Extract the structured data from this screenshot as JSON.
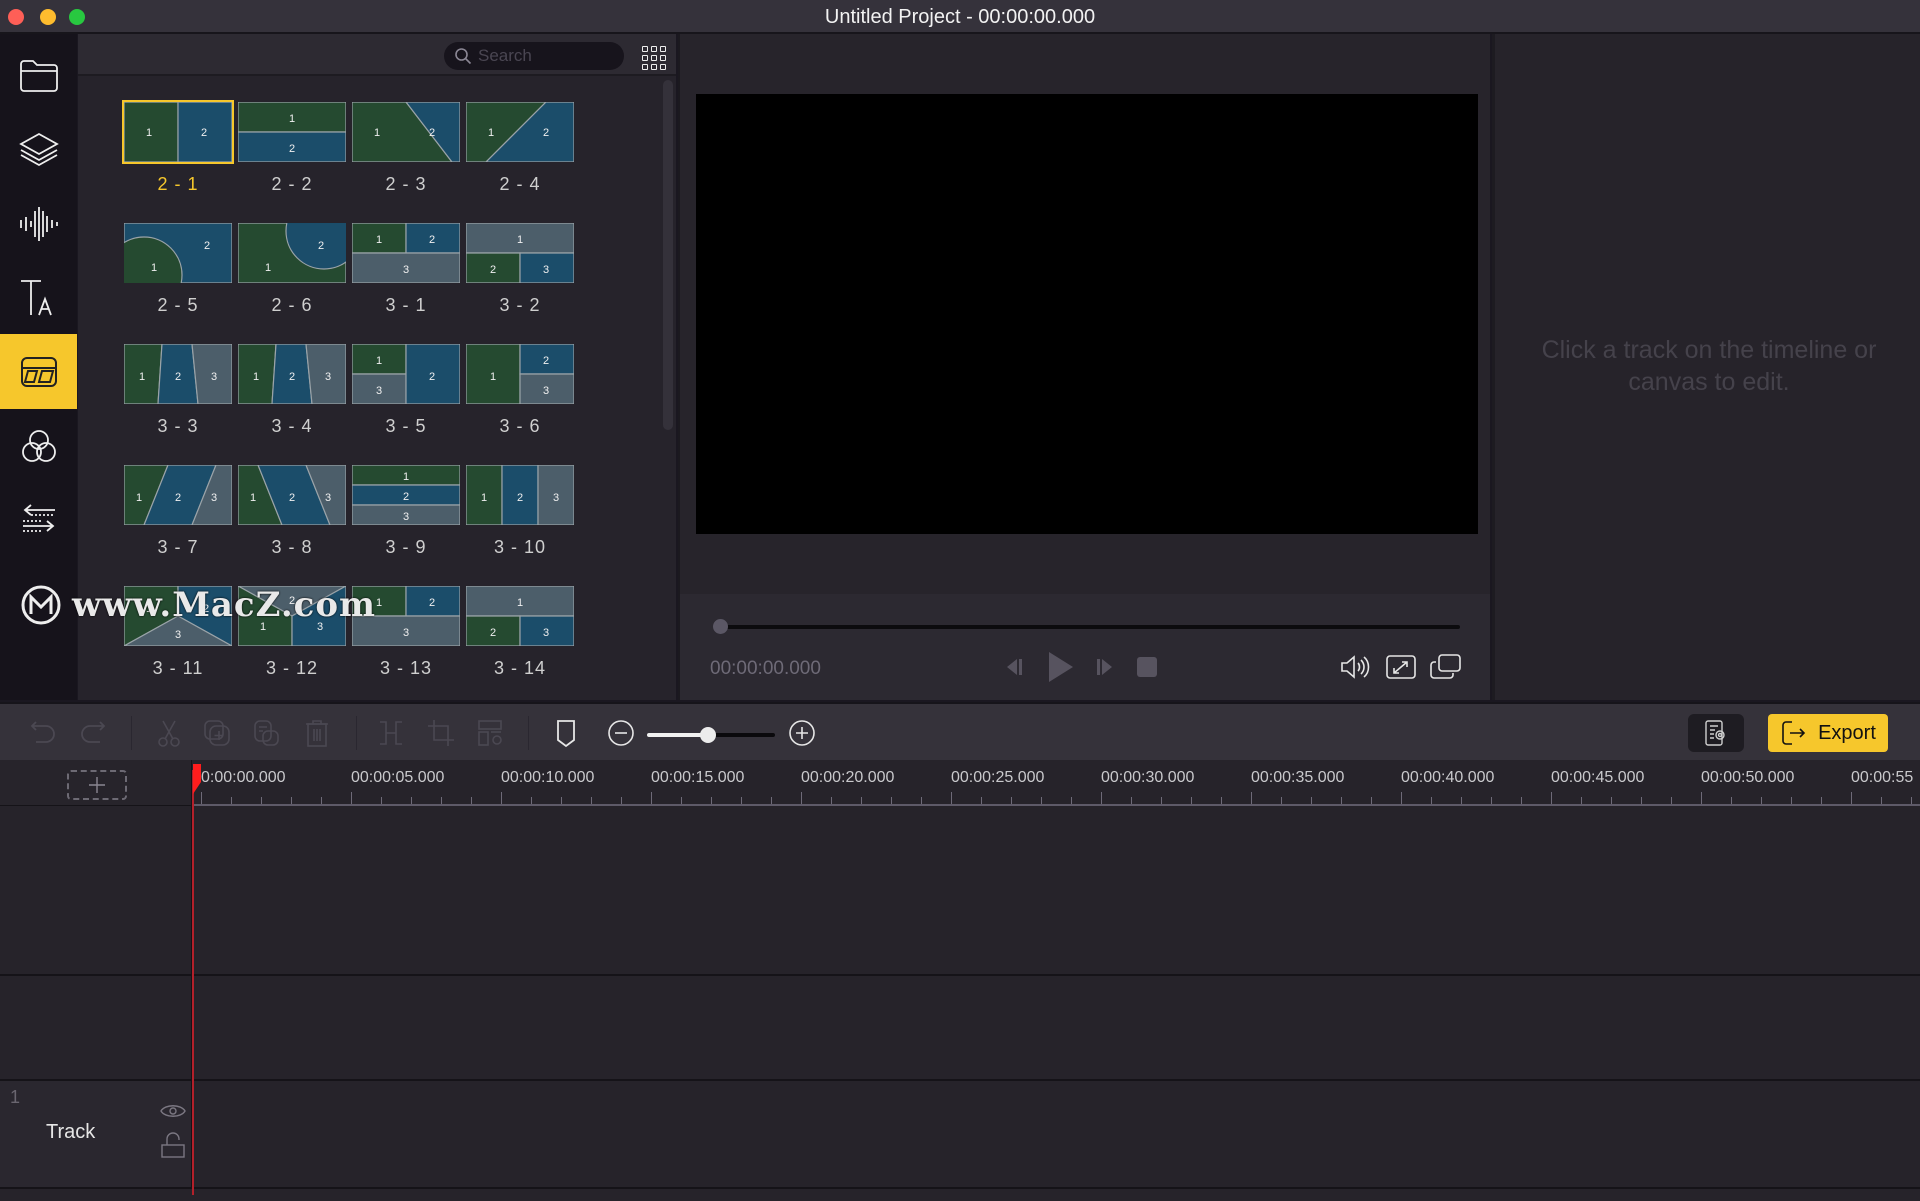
{
  "window": {
    "title": "Untitled Project - 00:00:00.000",
    "traffic_lights": [
      {
        "name": "close",
        "color": "#fe5f57"
      },
      {
        "name": "minimize",
        "color": "#febc2e"
      },
      {
        "name": "zoom",
        "color": "#28c840"
      }
    ]
  },
  "theme": {
    "accent": "#f6c72c",
    "playhead": "#ff1d1d"
  },
  "sidebar": {
    "items": [
      {
        "id": "media",
        "icon": "folder-icon",
        "active": false
      },
      {
        "id": "layers",
        "icon": "layers-icon",
        "active": false
      },
      {
        "id": "audio",
        "icon": "audio-waveform-icon",
        "active": false
      },
      {
        "id": "text",
        "icon": "text-icon",
        "active": false
      },
      {
        "id": "split-screen",
        "icon": "split-screen-template-icon",
        "active": true
      },
      {
        "id": "filters",
        "icon": "filters-circles-icon",
        "active": false
      },
      {
        "id": "transitions",
        "icon": "transition-arrows-icon",
        "active": false
      }
    ]
  },
  "watermark": {
    "text": "www.MacZ.com"
  },
  "templates": {
    "search_placeholder": "Search",
    "selected": "2 - 1",
    "items": [
      {
        "label": "2 - 1",
        "layout": "v2",
        "selected": true
      },
      {
        "label": "2 - 2",
        "layout": "h2"
      },
      {
        "label": "2 - 3",
        "layout": "diag2a"
      },
      {
        "label": "2 - 4",
        "layout": "diag2b"
      },
      {
        "label": "2 - 5",
        "layout": "circle-left"
      },
      {
        "label": "2 - 6",
        "layout": "circle-right"
      },
      {
        "label": "3 - 1",
        "layout": "t3a"
      },
      {
        "label": "3 - 2",
        "layout": "t3b"
      },
      {
        "label": "3 - 3",
        "layout": "v3slant"
      },
      {
        "label": "3 - 4",
        "layout": "v3slant"
      },
      {
        "label": "3 - 5",
        "layout": "l3left"
      },
      {
        "label": "3 - 6",
        "layout": "l3right"
      },
      {
        "label": "3 - 7",
        "layout": "v3slant2"
      },
      {
        "label": "3 - 8",
        "layout": "v3slant3"
      },
      {
        "label": "3 - 9",
        "layout": "h3"
      },
      {
        "label": "3 - 10",
        "layout": "v3"
      },
      {
        "label": "3 - 11",
        "layout": "y3"
      },
      {
        "label": "3 - 12",
        "layout": "y3inv"
      },
      {
        "label": "3 - 13",
        "layout": "t3a"
      },
      {
        "label": "3 - 14",
        "layout": "t3b"
      }
    ]
  },
  "preview": {
    "current_time": "00:00:00.000",
    "progress": 0,
    "controls": [
      "previous-frame",
      "play",
      "next-frame",
      "stop"
    ],
    "right_controls": [
      "volume",
      "fullscreen",
      "detach-window"
    ]
  },
  "properties": {
    "hint": "Click a track on the timeline or canvas to edit."
  },
  "toolbar": {
    "tools": [
      {
        "id": "undo",
        "icon": "undo-icon",
        "enabled": false
      },
      {
        "id": "redo",
        "icon": "redo-icon",
        "enabled": false
      },
      {
        "id": "cut",
        "icon": "scissors-icon",
        "enabled": false
      },
      {
        "id": "copy",
        "icon": "copy-icon",
        "enabled": false
      },
      {
        "id": "paste",
        "icon": "paste-icon",
        "enabled": false
      },
      {
        "id": "delete",
        "icon": "trash-icon",
        "enabled": false
      },
      {
        "id": "split",
        "icon": "split-icon",
        "enabled": false
      },
      {
        "id": "crop",
        "icon": "crop-icon",
        "enabled": false
      },
      {
        "id": "layout-settings",
        "icon": "layout-settings-icon",
        "enabled": false
      },
      {
        "id": "marker",
        "icon": "marker-icon",
        "enabled": true
      }
    ],
    "zoom_level": 0.48,
    "export_label": "Export"
  },
  "timeline": {
    "ruler_labels": [
      "0:00:00.000",
      "00:00:05.000",
      "00:00:10.000",
      "00:00:15.000",
      "00:00:20.000",
      "00:00:25.000",
      "00:00:30.000",
      "00:00:35.000",
      "00:00:40.000",
      "00:00:45.000",
      "00:00:50.000",
      "00:00:55"
    ],
    "ruler_seconds": [
      0,
      5,
      10,
      15,
      20,
      25,
      30,
      35,
      40,
      45,
      50,
      55
    ],
    "playhead_time": "00:00:00.000",
    "tracks": [
      {
        "number": "1",
        "name": "Track",
        "visible": true,
        "locked": false
      }
    ]
  }
}
